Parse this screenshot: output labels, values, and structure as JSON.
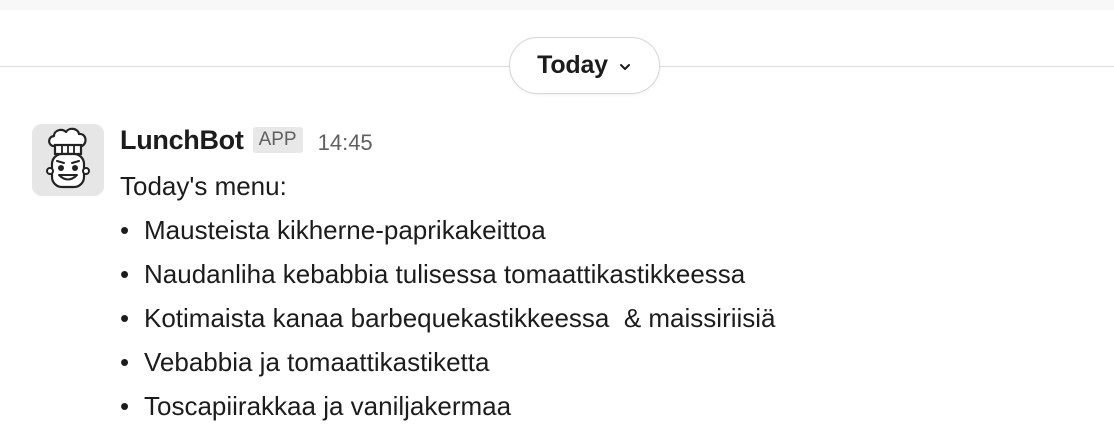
{
  "date_divider": {
    "label": "Today",
    "chevron_icon": "chevron-down-icon"
  },
  "message": {
    "avatar_icon": "chef-bot-icon",
    "sender": "LunchBot",
    "badge": "APP",
    "time": "14:45",
    "intro": "Today's menu:",
    "bullet": "•",
    "items": [
      "Mausteista kikherne-paprikakeittoa",
      "Naudanliha kebabbia tulisessa tomaattikastikkeessa",
      "Kotimaista kanaa barbequekastikkeessa  & maissiriisiä",
      "Vebabbia ja tomaattikastiketta",
      "Toscapiirakkaa ja vaniljakermaa"
    ]
  },
  "colors": {
    "text": "#1d1c1d",
    "muted": "#616061",
    "badge_bg": "#e8e8e8",
    "divider": "#dddddd"
  }
}
